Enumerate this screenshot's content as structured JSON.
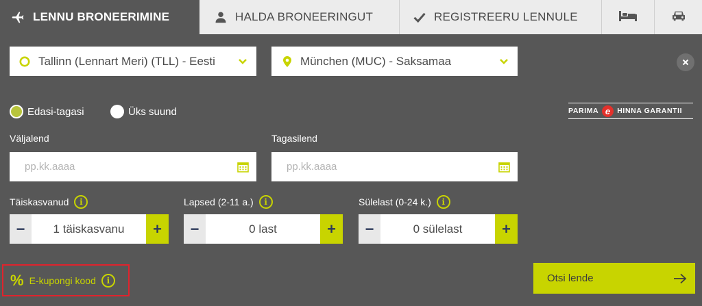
{
  "tabs": {
    "flight": "LENNU BRONEERIMINE",
    "manage": "HALDA BRONEERINGUT",
    "checkin": "REGISTREERU LENNULE",
    "hotel_icon": "bed-icon",
    "car_icon": "car-icon"
  },
  "route": {
    "from": "Tallinn (Lennart Meri) (TLL) - Eesti",
    "to": "München (MUC) - Saksamaa"
  },
  "trip_type": {
    "round_trip": "Edasi-tagasi",
    "one_way": "Üks suund",
    "selected": "round_trip"
  },
  "badge": {
    "word1": "PARIMA",
    "logo_letter": "e",
    "word2": "HINNA GARANTII"
  },
  "dates": {
    "depart_label": "Väljalend",
    "return_label": "Tagasilend",
    "depart_placeholder": "pp.kk.aaaa",
    "return_placeholder": "pp.kk.aaaa"
  },
  "passengers": {
    "adults_label": "Täiskasvanud",
    "adults_value": "1 täiskasvanu",
    "children_label": "Lapsed (2-11 a.)",
    "children_value": "0 last",
    "infants_label": "Sülelast (0-24 k.)",
    "infants_value": "0 sülelast",
    "minus": "−",
    "plus": "+"
  },
  "coupon": {
    "symbol": "%",
    "label": "E-kupongi kood"
  },
  "search": {
    "label": "Otsi lende"
  },
  "colors": {
    "background": "#575757",
    "accent": "#c8d400",
    "tab_inactive": "#ececec",
    "coupon_border": "#e0232d",
    "logo_red": "#e4312b"
  }
}
